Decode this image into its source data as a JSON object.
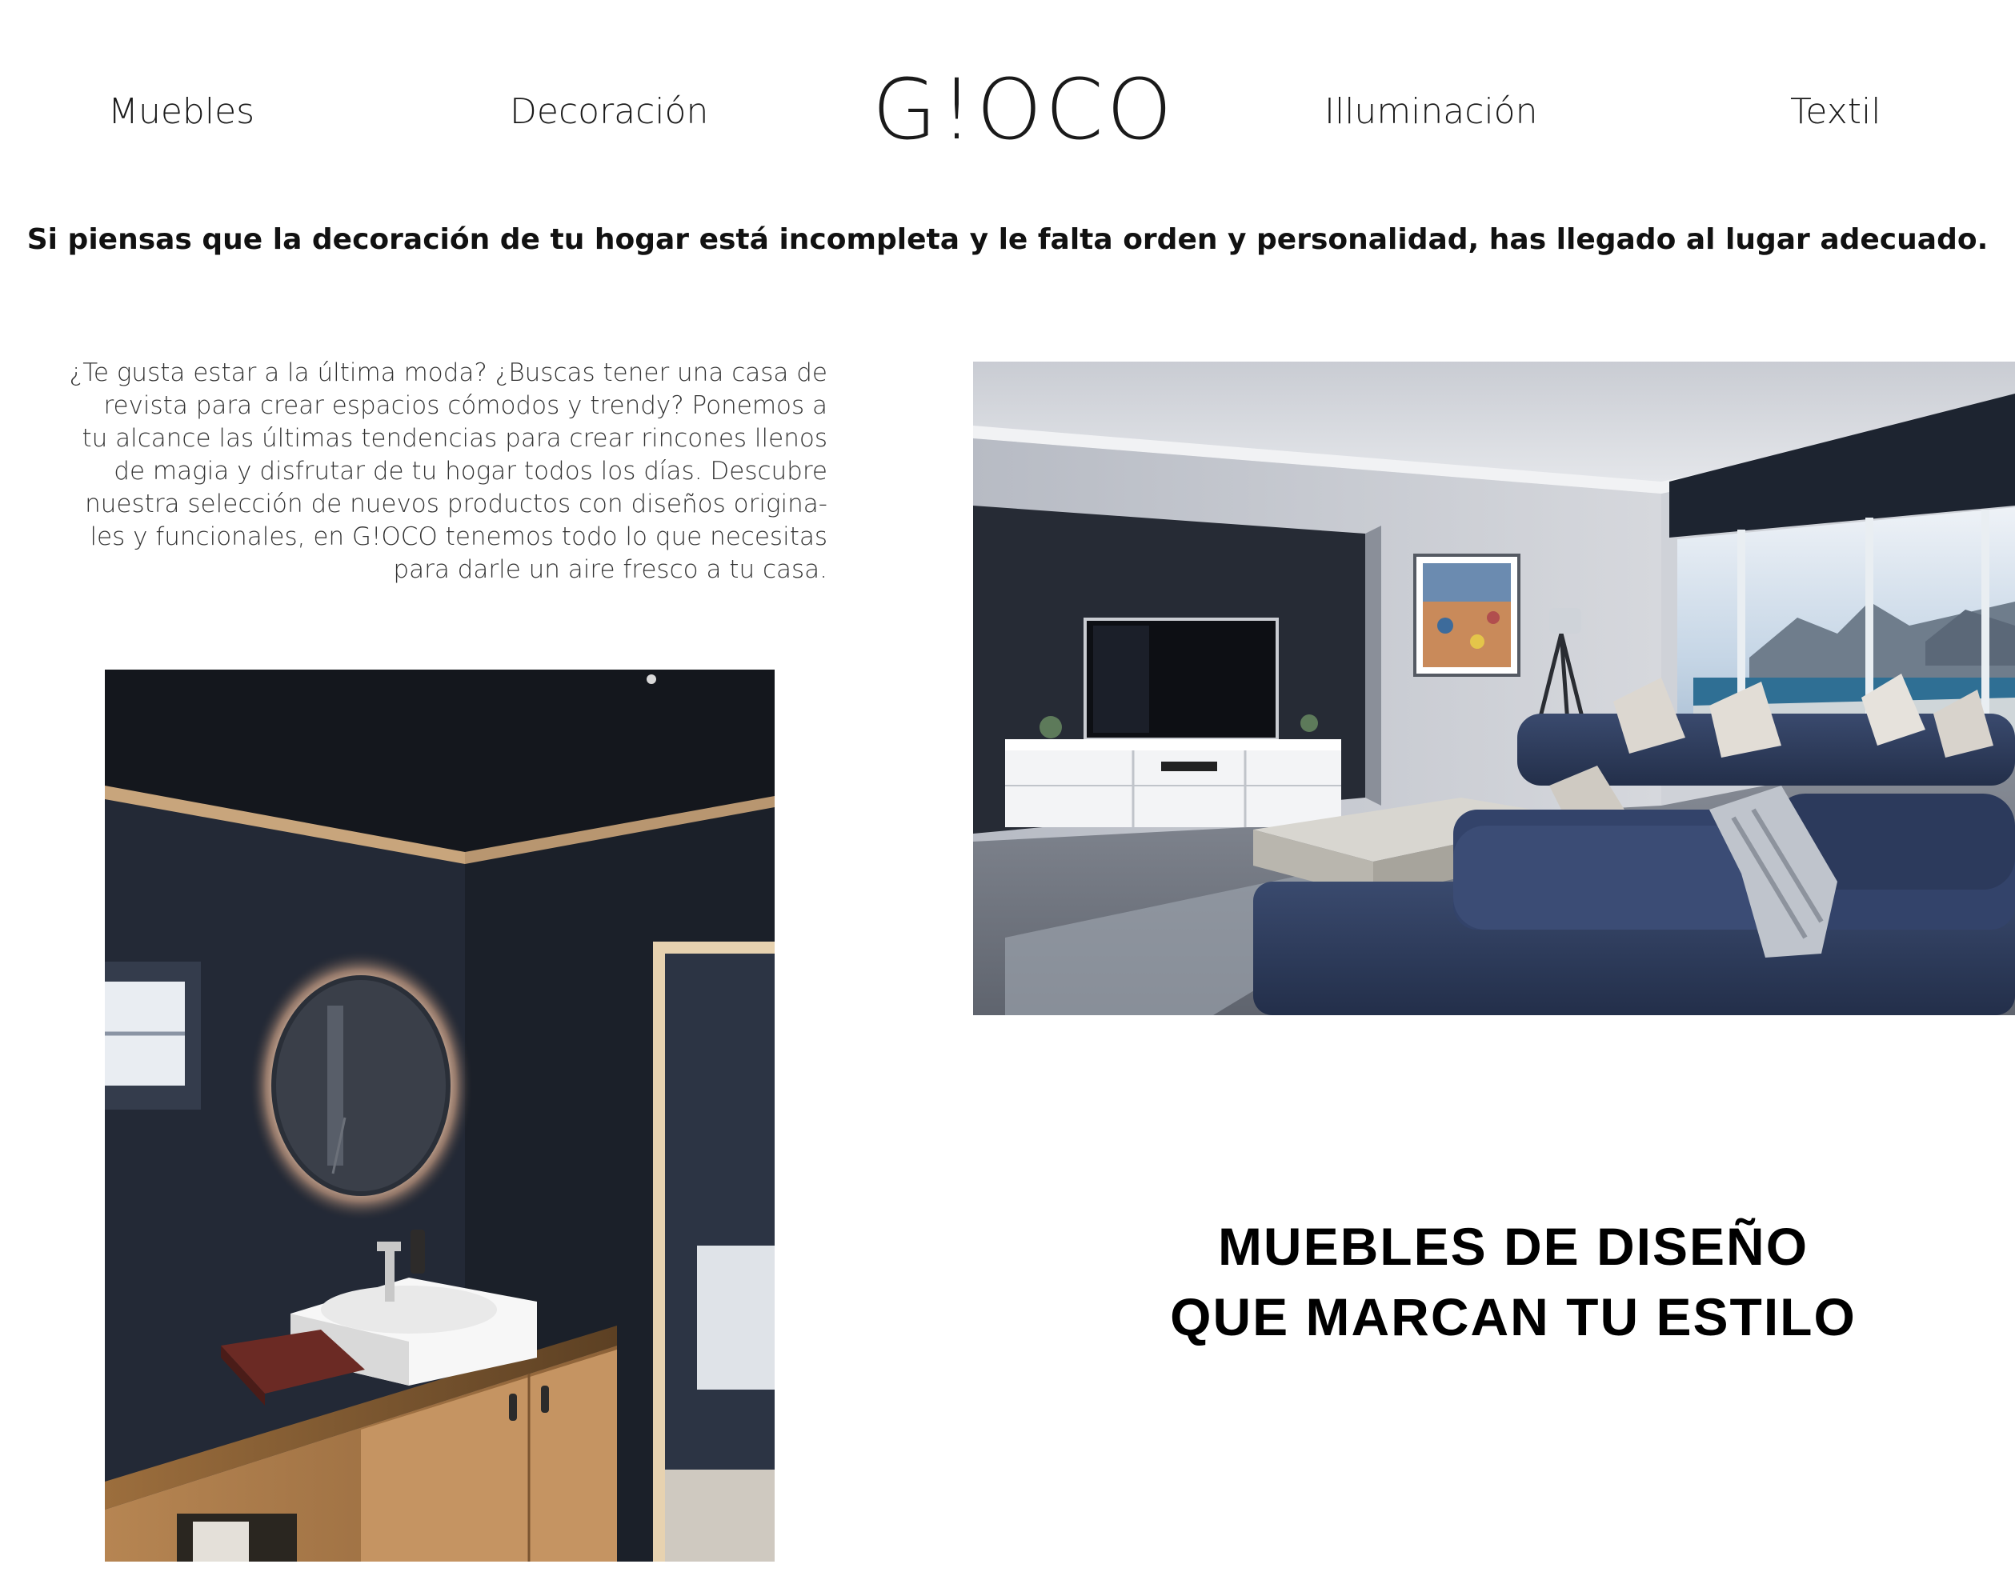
{
  "nav": {
    "items": [
      {
        "label": "Muebles"
      },
      {
        "label": "Decoración"
      },
      {
        "label": "Illuminación"
      },
      {
        "label": "Textil"
      }
    ]
  },
  "brand": {
    "logo_text": "G!OCO"
  },
  "tagline": "Si piensas que la decoración de tu hogar está incompleta y le falta orden y personalidad, has llegado al lugar adecuado.",
  "intro": {
    "lines": [
      "¿Te gusta estar a la última moda? ¿Buscas tener una casa de",
      "revista para crear espacios cómodos y trendy? Ponemos a",
      "tu alcance las últimas tendencias para crear rincones llenos",
      "de magia y disfrutar de tu hogar todos los días. Descubre",
      "nuestra selección de nuevos productos con diseños origina-",
      "les y funcionales, en G!OCO tenemos todo lo que necesitas",
      "para darle un aire fresco a tu casa."
    ]
  },
  "headline": {
    "lines": [
      "MUEBLES DE DISEÑO",
      "QUE MARCAN TU ESTILO"
    ]
  },
  "images": {
    "living_room": "living-room-photo",
    "bathroom": "bathroom-photo"
  },
  "colors": {
    "background": "#ffffff",
    "text": "#111111",
    "sofa_blue": "#2e3d5e",
    "wall_dark": "#232833"
  }
}
